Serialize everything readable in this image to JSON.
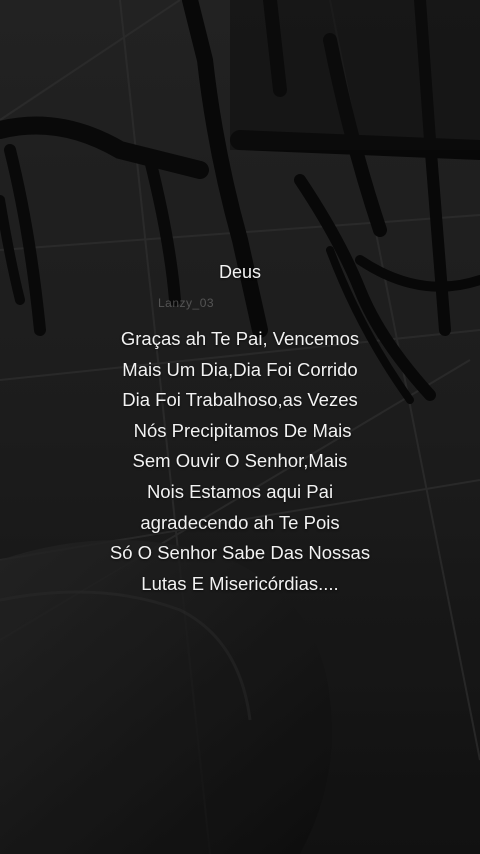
{
  "post": {
    "title": "Deus",
    "watermark": "Lanzy_03",
    "lines": [
      "Graças ah Te Pai, Vencemos",
      "Mais Um Dia,Dia Foi Corrido",
      "Dia Foi Trabalhoso,as Vezes",
      " Nós Precipitamos De Mais",
      "Sem Ouvir O Senhor,Mais",
      "Nois Estamos aqui Pai",
      "agradecendo ah Te Pois",
      "Só O Senhor Sabe Das Nossas",
      "Lutas E Misericórdias...."
    ]
  },
  "colors": {
    "text": "#f2f2f2",
    "background": "#1f1f1f"
  }
}
